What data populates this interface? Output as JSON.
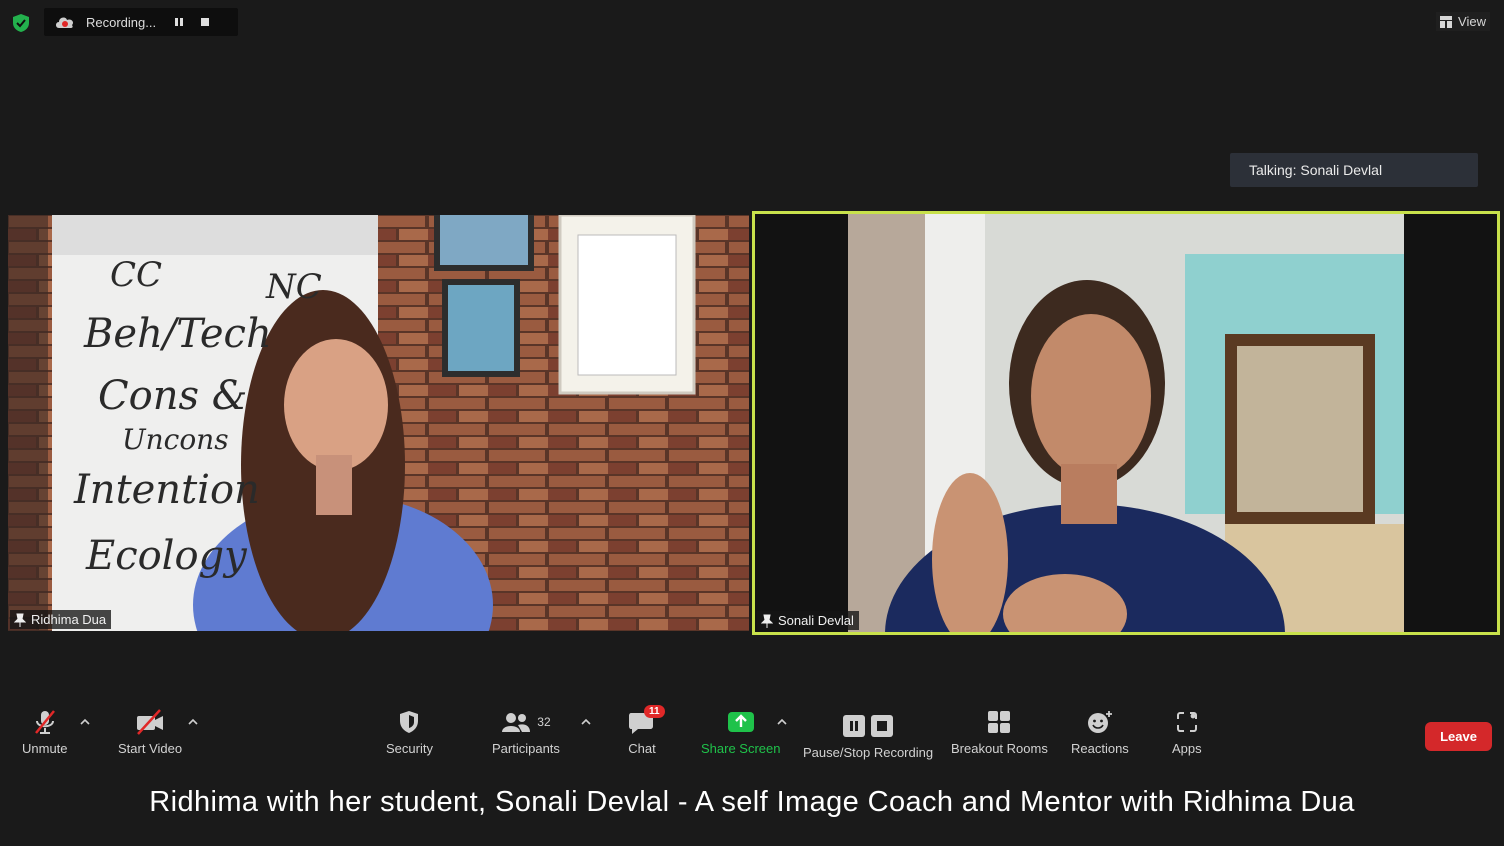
{
  "top_bar": {
    "recording_label": "Recording...",
    "view_label": "View"
  },
  "talking_indicator": "Talking: Sonali Devlal",
  "participants": [
    {
      "name": "Ridhima Dua",
      "active_speaker": false
    },
    {
      "name": "Sonali Devlal",
      "active_speaker": true
    }
  ],
  "whiteboard": {
    "lines": [
      "CC",
      "NC",
      "Beh/Tech",
      "Cons &",
      "Uncons",
      "Intention",
      "Ecology"
    ]
  },
  "toolbar": {
    "unmute": "Unmute",
    "start_video": "Start Video",
    "security": "Security",
    "participants": "Participants",
    "participants_count": "32",
    "chat": "Chat",
    "chat_badge": "11",
    "share_screen": "Share Screen",
    "pause_stop_recording": "Pause/Stop Recording",
    "breakout_rooms": "Breakout Rooms",
    "reactions": "Reactions",
    "apps": "Apps",
    "leave": "Leave"
  },
  "colors": {
    "active_speaker_border": "#c8e14b",
    "share_screen_green": "#1fc24a",
    "leave_red": "#d4282a",
    "badge_red": "#e02828"
  },
  "caption": "Ridhima with her student, Sonali Devlal - A self Image Coach and Mentor with Ridhima Dua"
}
